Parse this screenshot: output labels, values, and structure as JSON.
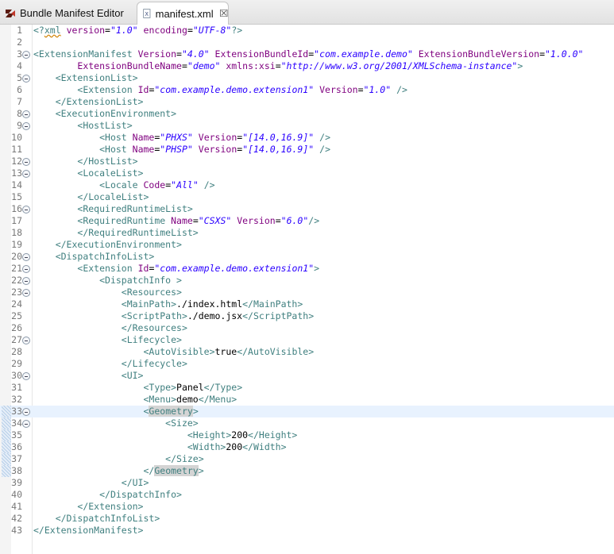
{
  "tabs": [
    {
      "label": "Bundle Manifest Editor",
      "icon": "bundle-editor-icon",
      "active": false
    },
    {
      "label": "manifest.xml",
      "icon": "xml-file-icon",
      "active": true,
      "close": "⮽"
    }
  ],
  "editor": {
    "current_line": 33,
    "changed_lines": [
      33,
      34,
      35,
      36,
      37,
      38
    ],
    "fold_lines": [
      3,
      5,
      8,
      9,
      12,
      13,
      16,
      20,
      21,
      22,
      23,
      27,
      30,
      33,
      34
    ],
    "lines": [
      [
        [
          "pi",
          "<?"
        ],
        [
          "pi sq",
          "xml"
        ],
        [
          "p",
          " "
        ],
        [
          "a",
          "version"
        ],
        [
          "p",
          "="
        ],
        [
          "v",
          "\"1.0\""
        ],
        [
          "p",
          " "
        ],
        [
          "a",
          "encoding"
        ],
        [
          "p",
          "="
        ],
        [
          "v",
          "\"UTF-8\""
        ],
        [
          "pi",
          "?>"
        ]
      ],
      [],
      [
        [
          "t",
          "<ExtensionManifest"
        ],
        [
          "p",
          " "
        ],
        [
          "a",
          "Version"
        ],
        [
          "p",
          "="
        ],
        [
          "v",
          "\"4.0\""
        ],
        [
          "p",
          " "
        ],
        [
          "a",
          "ExtensionBundleId"
        ],
        [
          "p",
          "="
        ],
        [
          "v",
          "\"com.example.demo\""
        ],
        [
          "p",
          " "
        ],
        [
          "a",
          "ExtensionBundleVersion"
        ],
        [
          "p",
          "="
        ],
        [
          "v",
          "\"1.0.0\""
        ]
      ],
      [
        [
          "p",
          "        "
        ],
        [
          "a",
          "ExtensionBundleName"
        ],
        [
          "p",
          "="
        ],
        [
          "v",
          "\"demo\""
        ],
        [
          "p",
          " "
        ],
        [
          "a",
          "xmlns:xsi"
        ],
        [
          "p",
          "="
        ],
        [
          "v",
          "\"http://www.w3.org/2001/XMLSchema-instance\""
        ],
        [
          "t",
          ">"
        ]
      ],
      [
        [
          "p",
          "    "
        ],
        [
          "t",
          "<ExtensionList>"
        ]
      ],
      [
        [
          "p",
          "        "
        ],
        [
          "t",
          "<Extension"
        ],
        [
          "p",
          " "
        ],
        [
          "a",
          "Id"
        ],
        [
          "p",
          "="
        ],
        [
          "v",
          "\"com.example.demo.extension1\""
        ],
        [
          "p",
          " "
        ],
        [
          "a",
          "Version"
        ],
        [
          "p",
          "="
        ],
        [
          "v",
          "\"1.0\""
        ],
        [
          "p",
          " "
        ],
        [
          "t",
          "/>"
        ]
      ],
      [
        [
          "p",
          "    "
        ],
        [
          "t",
          "</ExtensionList>"
        ]
      ],
      [
        [
          "p",
          "    "
        ],
        [
          "t",
          "<ExecutionEnvironment>"
        ]
      ],
      [
        [
          "p",
          "        "
        ],
        [
          "t",
          "<HostList>"
        ]
      ],
      [
        [
          "p",
          "            "
        ],
        [
          "t",
          "<Host"
        ],
        [
          "p",
          " "
        ],
        [
          "a",
          "Name"
        ],
        [
          "p",
          "="
        ],
        [
          "v",
          "\"PHXS\""
        ],
        [
          "p",
          " "
        ],
        [
          "a",
          "Version"
        ],
        [
          "p",
          "="
        ],
        [
          "v",
          "\"[14.0,16.9]\""
        ],
        [
          "p",
          " "
        ],
        [
          "t",
          "/>"
        ]
      ],
      [
        [
          "p",
          "            "
        ],
        [
          "t",
          "<Host"
        ],
        [
          "p",
          " "
        ],
        [
          "a",
          "Name"
        ],
        [
          "p",
          "="
        ],
        [
          "v",
          "\"PHSP\""
        ],
        [
          "p",
          " "
        ],
        [
          "a",
          "Version"
        ],
        [
          "p",
          "="
        ],
        [
          "v",
          "\"[14.0,16.9]\""
        ],
        [
          "p",
          " "
        ],
        [
          "t",
          "/>"
        ]
      ],
      [
        [
          "p",
          "        "
        ],
        [
          "t",
          "</HostList>"
        ]
      ],
      [
        [
          "p",
          "        "
        ],
        [
          "t",
          "<LocaleList>"
        ]
      ],
      [
        [
          "p",
          "            "
        ],
        [
          "t",
          "<Locale"
        ],
        [
          "p",
          " "
        ],
        [
          "a",
          "Code"
        ],
        [
          "p",
          "="
        ],
        [
          "v",
          "\"All\""
        ],
        [
          "p",
          " "
        ],
        [
          "t",
          "/>"
        ]
      ],
      [
        [
          "p",
          "        "
        ],
        [
          "t",
          "</LocaleList>"
        ]
      ],
      [
        [
          "p",
          "        "
        ],
        [
          "t",
          "<RequiredRuntimeList>"
        ]
      ],
      [
        [
          "p",
          "        "
        ],
        [
          "t",
          "<RequiredRuntime"
        ],
        [
          "p",
          " "
        ],
        [
          "a",
          "Name"
        ],
        [
          "p",
          "="
        ],
        [
          "v",
          "\"CSXS\""
        ],
        [
          "p",
          " "
        ],
        [
          "a",
          "Version"
        ],
        [
          "p",
          "="
        ],
        [
          "v",
          "\"6.0\""
        ],
        [
          "t",
          "/>"
        ]
      ],
      [
        [
          "p",
          "        "
        ],
        [
          "t",
          "</RequiredRuntimeList>"
        ]
      ],
      [
        [
          "p",
          "    "
        ],
        [
          "t",
          "</ExecutionEnvironment>"
        ]
      ],
      [
        [
          "p",
          "    "
        ],
        [
          "t",
          "<DispatchInfoList>"
        ]
      ],
      [
        [
          "p",
          "        "
        ],
        [
          "t",
          "<Extension"
        ],
        [
          "p",
          " "
        ],
        [
          "a",
          "Id"
        ],
        [
          "p",
          "="
        ],
        [
          "v",
          "\"com.example.demo.extension1\""
        ],
        [
          "t",
          ">"
        ]
      ],
      [
        [
          "p",
          "            "
        ],
        [
          "t",
          "<DispatchInfo >"
        ]
      ],
      [
        [
          "p",
          "                "
        ],
        [
          "t",
          "<Resources>"
        ]
      ],
      [
        [
          "p",
          "                "
        ],
        [
          "t",
          "<MainPath>"
        ],
        [
          "x",
          "./index.html"
        ],
        [
          "t",
          "</MainPath>"
        ]
      ],
      [
        [
          "p",
          "                "
        ],
        [
          "t",
          "<ScriptPath>"
        ],
        [
          "x",
          "./demo.jsx"
        ],
        [
          "t",
          "</ScriptPath>"
        ]
      ],
      [
        [
          "p",
          "                "
        ],
        [
          "t",
          "</Resources>"
        ]
      ],
      [
        [
          "p",
          "                "
        ],
        [
          "t",
          "<Lifecycle>"
        ]
      ],
      [
        [
          "p",
          "                    "
        ],
        [
          "t",
          "<AutoVisible>"
        ],
        [
          "x",
          "true"
        ],
        [
          "t",
          "</AutoVisible>"
        ]
      ],
      [
        [
          "p",
          "                "
        ],
        [
          "t",
          "</Lifecycle>"
        ]
      ],
      [
        [
          "p",
          "                "
        ],
        [
          "t",
          "<UI>"
        ]
      ],
      [
        [
          "p",
          "                    "
        ],
        [
          "t",
          "<Type>"
        ],
        [
          "x",
          "Panel"
        ],
        [
          "t",
          "</Type>"
        ]
      ],
      [
        [
          "p",
          "                    "
        ],
        [
          "t",
          "<Menu>"
        ],
        [
          "x",
          "demo"
        ],
        [
          "t",
          "</Menu>"
        ]
      ],
      [
        [
          "p",
          "                    "
        ],
        [
          "t",
          "<"
        ],
        [
          "t hl",
          "Geometry"
        ],
        [
          "t",
          ">"
        ]
      ],
      [
        [
          "p",
          "                        "
        ],
        [
          "t",
          "<Size>"
        ]
      ],
      [
        [
          "p",
          "                            "
        ],
        [
          "t",
          "<Height>"
        ],
        [
          "x",
          "200"
        ],
        [
          "t",
          "</Height>"
        ]
      ],
      [
        [
          "p",
          "                            "
        ],
        [
          "t",
          "<Width>"
        ],
        [
          "x",
          "200"
        ],
        [
          "t",
          "</Width>"
        ]
      ],
      [
        [
          "p",
          "                        "
        ],
        [
          "t",
          "</Size>"
        ]
      ],
      [
        [
          "p",
          "                    "
        ],
        [
          "t",
          "</"
        ],
        [
          "t hl",
          "Geometry"
        ],
        [
          "t",
          ">"
        ]
      ],
      [
        [
          "p",
          "                "
        ],
        [
          "t",
          "</UI>"
        ]
      ],
      [
        [
          "p",
          "            "
        ],
        [
          "t",
          "</DispatchInfo>"
        ]
      ],
      [
        [
          "p",
          "        "
        ],
        [
          "t",
          "</Extension>"
        ]
      ],
      [
        [
          "p",
          "    "
        ],
        [
          "t",
          "</DispatchInfoList>"
        ]
      ],
      [
        [
          "t",
          "</ExtensionManifest>"
        ]
      ]
    ]
  }
}
